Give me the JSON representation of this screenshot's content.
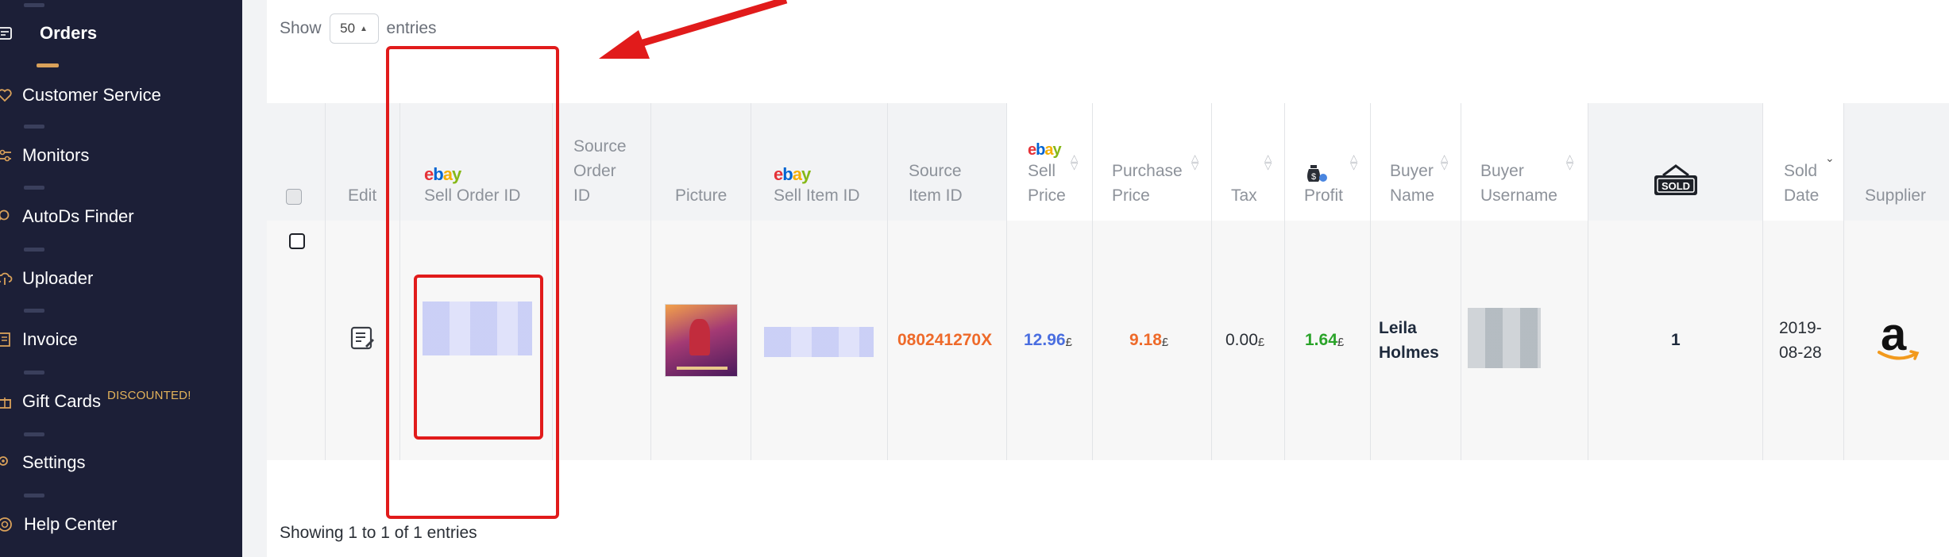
{
  "sidebar": {
    "items": [
      {
        "label": "Orders",
        "icon": "orders-icon"
      },
      {
        "label": "Customer Service",
        "icon": "heart-icon"
      },
      {
        "label": "Monitors",
        "icon": "monitors-icon"
      },
      {
        "label": "AutoDs Finder",
        "icon": "search-icon"
      },
      {
        "label": "Uploader",
        "icon": "upload-cloud-icon"
      },
      {
        "label": "Invoice",
        "icon": "invoice-icon"
      },
      {
        "label": "Gift Cards",
        "icon": "gift-icon",
        "badge": "DISCOUNTED!"
      },
      {
        "label": "Settings",
        "icon": "gear-icon"
      },
      {
        "label": "Help Center",
        "icon": "lifebuoy-icon"
      }
    ]
  },
  "controls": {
    "show_label": "Show",
    "page_size": "50",
    "entries_label": "entries"
  },
  "table": {
    "ebay_logo": {
      "e": "e",
      "b": "b",
      "a": "a",
      "y": "y"
    },
    "headers": {
      "edit": "Edit",
      "sell_order_id": "Sell Order ID",
      "source_order_id_1": "Source",
      "source_order_id_2": "Order",
      "source_order_id_3": "ID",
      "picture": "Picture",
      "sell_item_id": "Sell Item ID",
      "source_item_id_1": "Source",
      "source_item_id_2": "Item ID",
      "sell_price_1": "Sell",
      "sell_price_2": "Price",
      "purchase_price_1": "Purchase",
      "purchase_price_2": "Price",
      "tax": "Tax",
      "profit": "Profit",
      "buyer_name_1": "Buyer",
      "buyer_name_2": "Name",
      "buyer_username_1": "Buyer",
      "buyer_username_2": "Username",
      "sold_badge": "SOLD",
      "sold_date_1": "Sold",
      "sold_date_2": "Date",
      "supplier": "Supplier"
    },
    "row": {
      "source_item_id": "080241270X",
      "sell_price": "12.96",
      "purchase_price": "9.18",
      "tax": "0.00",
      "profit": "1.64",
      "currency": "£",
      "buyer_name_1": "Leila",
      "buyer_name_2": "Holmes",
      "quantity": "1",
      "sold_date_1": "2019-",
      "sold_date_2": "08-28",
      "supplier_logo": "a"
    }
  },
  "footer": {
    "summary": "Showing 1 to 1 of 1 entries"
  },
  "colors": {
    "sidebar_bg": "#1c1f37",
    "accent": "#d9a15a",
    "annotation_red": "#e11b1b",
    "price_blue": "#4a6ee0",
    "purchase_orange": "#ee6a2a",
    "profit_green": "#2aa329"
  }
}
